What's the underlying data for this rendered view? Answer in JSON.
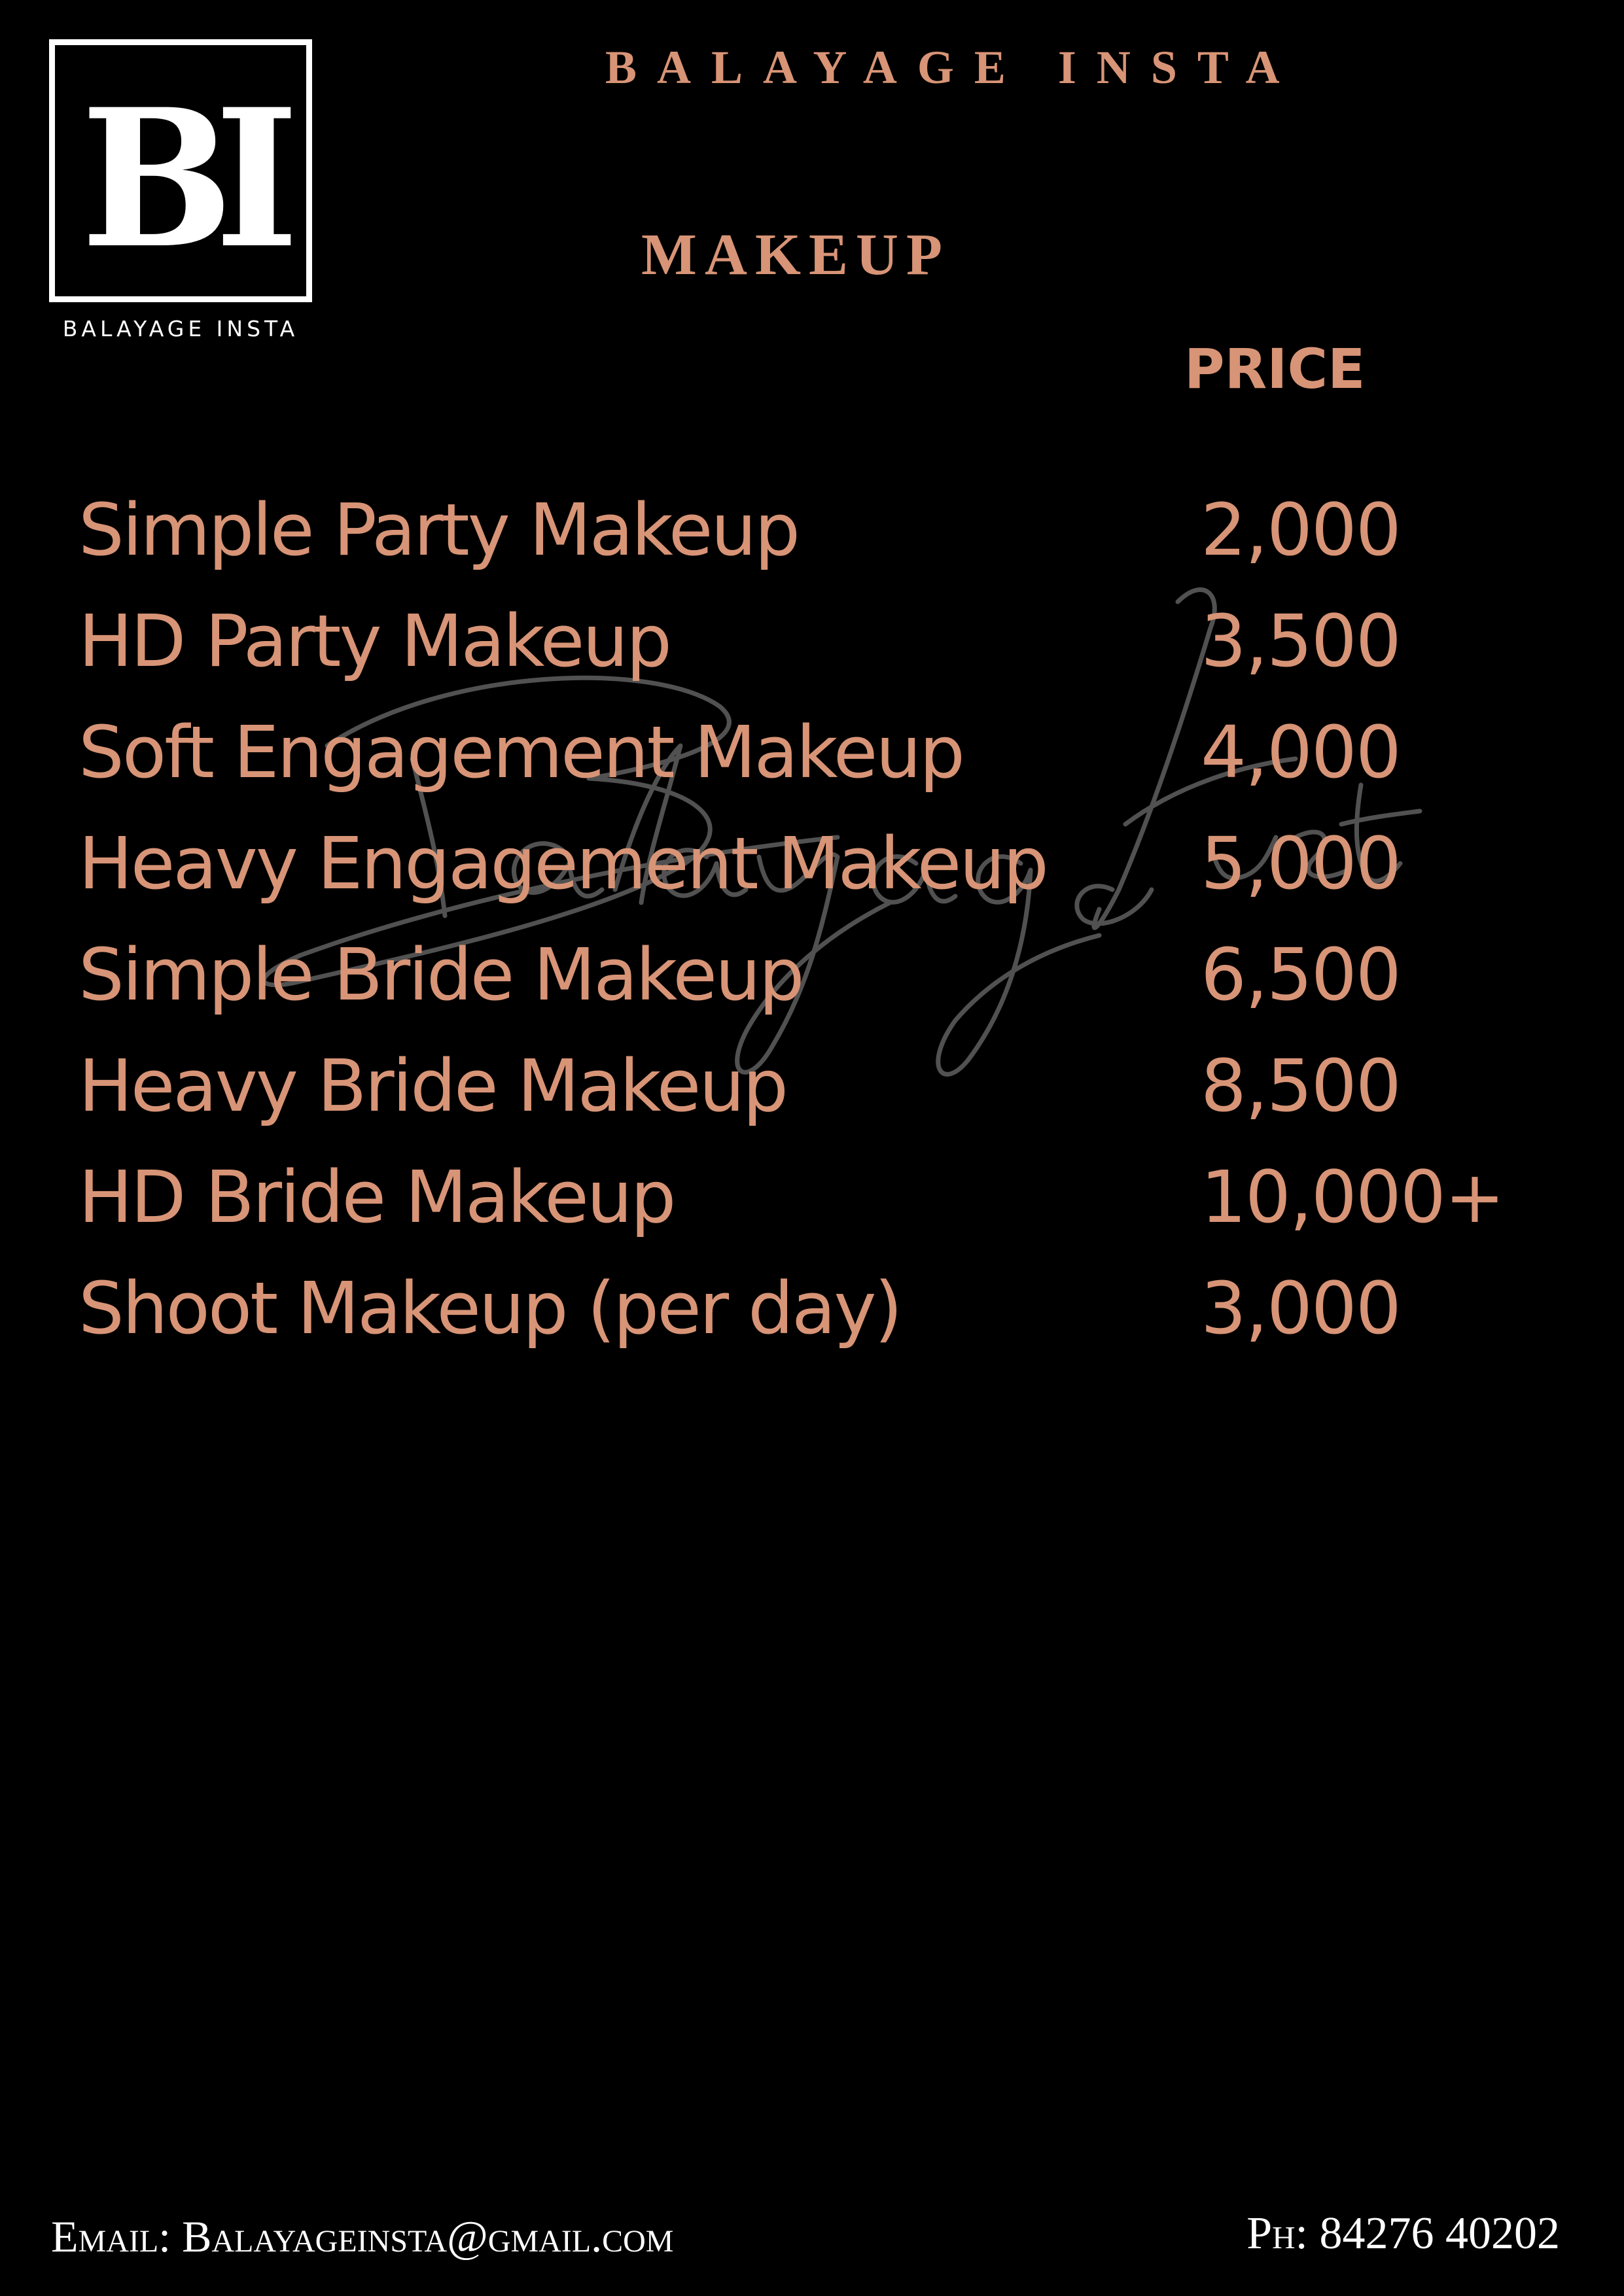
{
  "logo": {
    "monogram": "BI",
    "caption": "BALAYAGE INSTA"
  },
  "header": {
    "brand": "BALAYAGE INSTA",
    "section_title": "MAKEUP",
    "price_label": "PRICE"
  },
  "watermark": {
    "text": "Balayage Insta"
  },
  "menu": [
    {
      "name": "Simple Party Makeup",
      "price": "2,000"
    },
    {
      "name": "HD Party Makeup",
      "price": "3,500"
    },
    {
      "name": "Soft Engagement Makeup",
      "price": "4,000"
    },
    {
      "name": "Heavy Engagement Makeup",
      "price": "5,000"
    },
    {
      "name": "Simple Bride Makeup",
      "price": "6,500"
    },
    {
      "name": "Heavy Bride Makeup",
      "price": "8,500"
    },
    {
      "name": "HD Bride Makeup",
      "price": "10,000+"
    },
    {
      "name": "Shoot Makeup (per day)",
      "price": "3,000"
    }
  ],
  "footer": {
    "email": "Email: Balayageinsta@gmail.com",
    "phone": "Ph: 84276 40202"
  },
  "colors": {
    "background": "#000000",
    "accent": "#d89476",
    "logo": "#ffffff",
    "watermark": "#5a5a5a"
  }
}
